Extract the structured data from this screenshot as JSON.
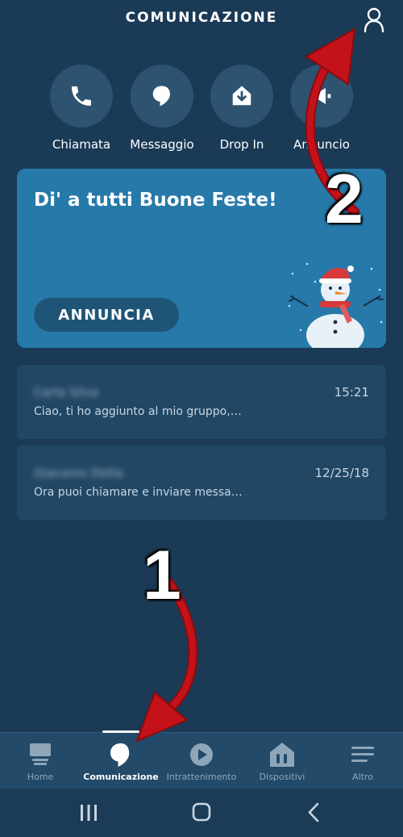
{
  "header": {
    "title": "COMUNICAZIONE"
  },
  "actions": [
    {
      "label": "Chiamata",
      "icon": "phone-icon"
    },
    {
      "label": "Messaggio",
      "icon": "speech-bubble-icon"
    },
    {
      "label": "Drop In",
      "icon": "drop-in-icon"
    },
    {
      "label": "Annuncio",
      "icon": "megaphone-icon"
    }
  ],
  "promo": {
    "title": "Di' a tutti Buone Feste!",
    "button_label": "ANNUNCIA"
  },
  "conversations": [
    {
      "name": "Carla Silva",
      "time": "15:21",
      "preview": "Ciao, ti ho aggiunto al mio gruppo,…"
    },
    {
      "name": "Giacomo Delta",
      "time": "12/25/18",
      "preview": "Ora puoi chiamare e inviare messa…"
    }
  ],
  "tabs": [
    {
      "label": "Home",
      "icon": "home-device-icon",
      "active": false
    },
    {
      "label": "Comunicazione",
      "icon": "speech-bubble-icon",
      "active": true
    },
    {
      "label": "Intrattenimento",
      "icon": "play-icon",
      "active": false
    },
    {
      "label": "Dispositivi",
      "icon": "devices-icon",
      "active": false
    },
    {
      "label": "Altro",
      "icon": "menu-icon",
      "active": false
    }
  ],
  "annotations": {
    "step1": "1",
    "step2": "2"
  },
  "colors": {
    "background": "#1a3a55",
    "card": "#214765",
    "promo": "#2679a8",
    "arrow": "#c4121a"
  }
}
